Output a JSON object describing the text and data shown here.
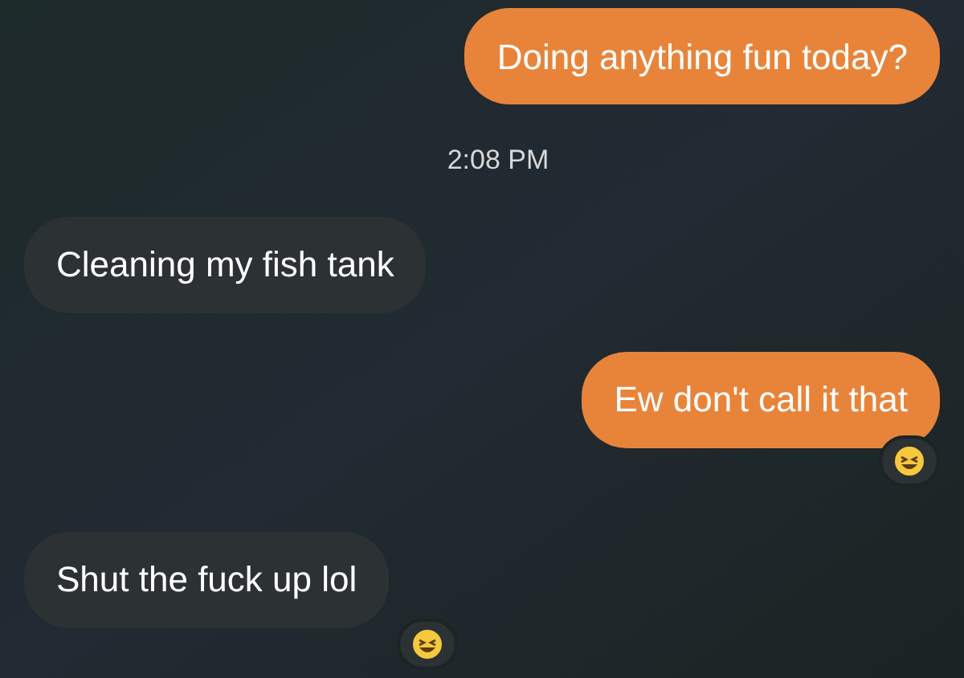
{
  "messages": [
    {
      "kind": "sent",
      "text": "Doing anything fun today?",
      "reacted": false
    },
    {
      "kind": "time",
      "text": "2:08 PM"
    },
    {
      "kind": "received",
      "text": "Cleaning my fish tank",
      "reacted": false
    },
    {
      "kind": "sent",
      "text": "Ew don't call it that",
      "reacted": true
    },
    {
      "kind": "received",
      "text": "Shut the fuck up lol",
      "reacted": true
    }
  ]
}
